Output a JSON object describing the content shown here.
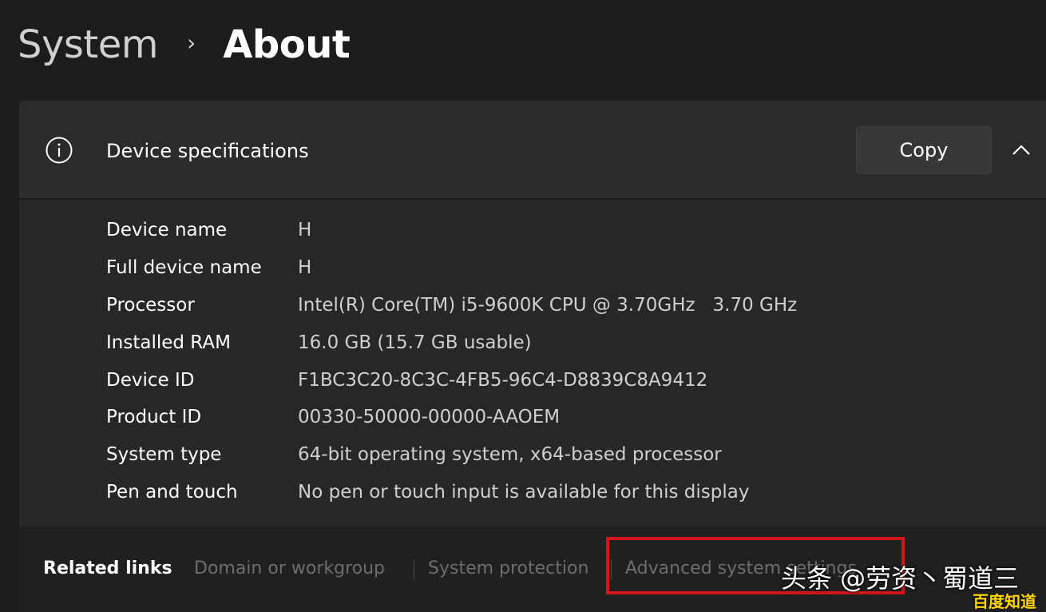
{
  "breadcrumb": {
    "parent": "System",
    "separator": "›",
    "current": "About"
  },
  "device_specs": {
    "title": "Device specifications",
    "copy_label": "Copy",
    "rows": [
      {
        "label": "Device name",
        "value": "H"
      },
      {
        "label": "Full device name",
        "value": "H"
      },
      {
        "label": "Processor",
        "value": "Intel(R) Core(TM) i5-9600K CPU @ 3.70GHz   3.70 GHz"
      },
      {
        "label": "Installed RAM",
        "value": "16.0 GB (15.7 GB usable)"
      },
      {
        "label": "Device ID",
        "value": "F1BC3C20-8C3C-4FB5-96C4-D8839C8A9412"
      },
      {
        "label": "Product ID",
        "value": "00330-50000-00000-AAOEM"
      },
      {
        "label": "System type",
        "value": "64-bit operating system, x64-based processor"
      },
      {
        "label": "Pen and touch",
        "value": "No pen or touch input is available for this display"
      }
    ]
  },
  "related_links": {
    "title": "Related links",
    "links": [
      "Domain or workgroup",
      "System protection",
      "Advanced system settings"
    ]
  },
  "watermark": {
    "main": "头条 @劳资丶蜀道三",
    "logo": "百度知道"
  },
  "colors": {
    "background": "#1c1c1c",
    "card": "#2b2b2b",
    "highlight": "#d2151b"
  }
}
